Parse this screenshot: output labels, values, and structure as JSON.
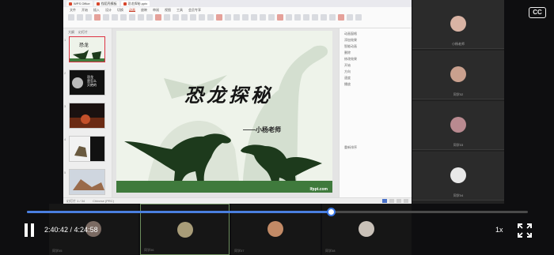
{
  "app": {
    "tabs": [
      {
        "label": "WPS Office",
        "active": false
      },
      {
        "label": "找稻壳模板",
        "active": false
      },
      {
        "label": "恐龙探秘.pptx",
        "active": true
      }
    ],
    "menu": [
      "文件",
      "开始",
      "插入",
      "设计",
      "切换",
      "动画",
      "放映",
      "审阅",
      "视图",
      "工具",
      "会员专享"
    ],
    "menu_selected_index": 5
  },
  "thumbnails": {
    "tabs": [
      "大纲",
      "幻灯片"
    ],
    "items": [
      {
        "num": "1"
      },
      {
        "num": "2",
        "caption": "恐龙\n是怎么\n灭绝的"
      },
      {
        "num": "3"
      },
      {
        "num": "4"
      },
      {
        "num": "5"
      }
    ]
  },
  "slide": {
    "title": "恐龙探秘",
    "subtitle": "——小杨老师",
    "watermark": "lfppt.com",
    "colors": {
      "footer": "#3f7a3c",
      "dino": "#1d3a1c",
      "bg": "#eef3ea"
    }
  },
  "right_panel": {
    "rows": [
      "动画窗格",
      "添加效果",
      "智能动画",
      "删除",
      "修改效果",
      "开始",
      "方向",
      "速度",
      "播放",
      "",
      "",
      "",
      "",
      "",
      "",
      "",
      "",
      "",
      "重新排序"
    ]
  },
  "statusbar": {
    "left": "幻灯片 1 / 34",
    "notes": "Chinese (PRC)"
  },
  "participants": [
    {
      "name": "小杨老师",
      "color": "#d9b3a4"
    },
    {
      "name": "同学02",
      "color": "#c9a08e"
    },
    {
      "name": "同学03",
      "color": "#b98a90"
    },
    {
      "name": "同学04",
      "color": "#e8e8e8"
    }
  ],
  "strip": [
    {
      "name": "同学05",
      "color": "#7a6a62"
    },
    {
      "name": "同学06",
      "color": "#a89c78"
    },
    {
      "name": "同学07",
      "color": "#c28a66"
    },
    {
      "name": "同学08",
      "color": "#c9c1b8"
    }
  ],
  "player": {
    "current_time": "2:40:42",
    "separator": " / ",
    "total_time": "4:24:58",
    "progress": 0.607,
    "speed": "1x",
    "cc": "CC"
  }
}
